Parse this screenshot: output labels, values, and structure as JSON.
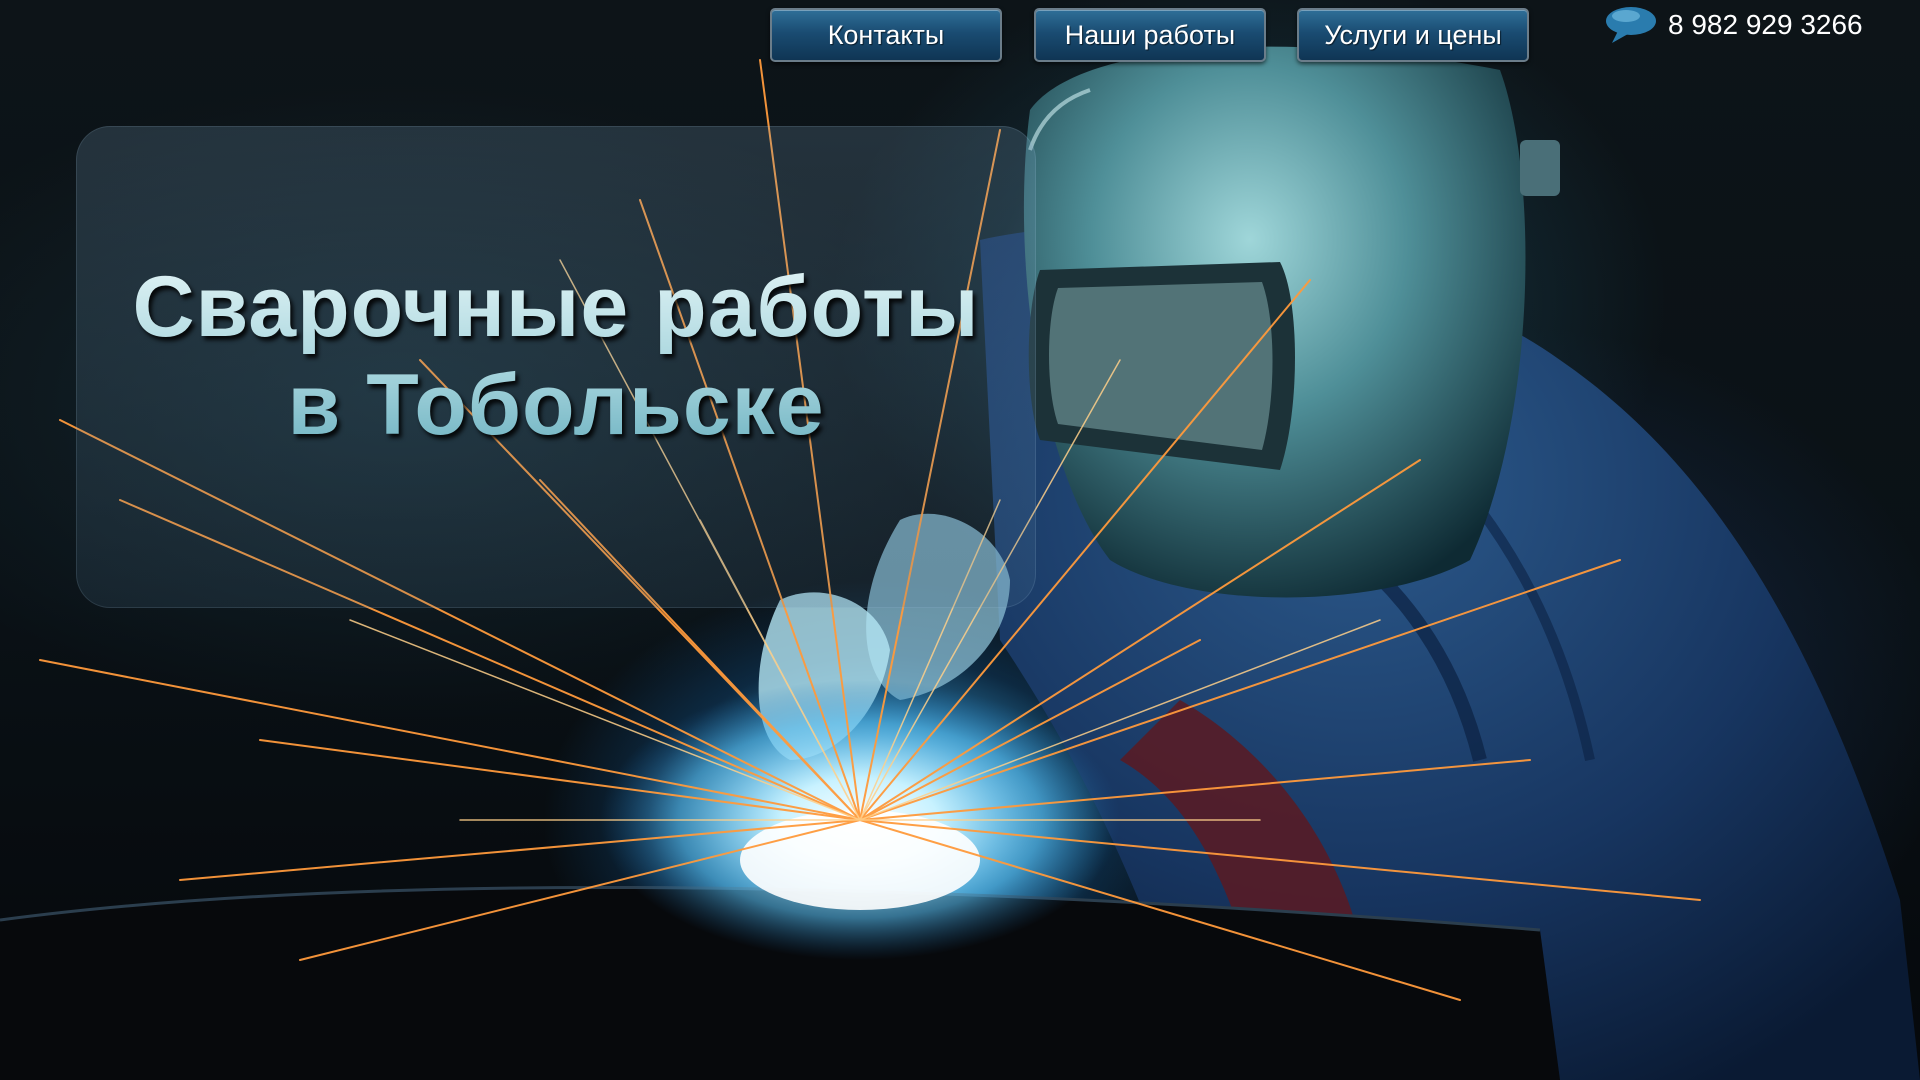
{
  "nav": {
    "contacts": "Контакты",
    "works": "Наши работы",
    "services": "Услуги и цены"
  },
  "phone": {
    "icon": "speech-bubble-icon",
    "number": "8 982 929 3266"
  },
  "hero": {
    "line1": "Сварочные работы",
    "line2": "в Тобольске"
  },
  "colors": {
    "nav_button": "#1a4c72",
    "headline": "#bfe0e6",
    "glow": "#7fd8ff",
    "sparks": "#ff9a3c"
  }
}
